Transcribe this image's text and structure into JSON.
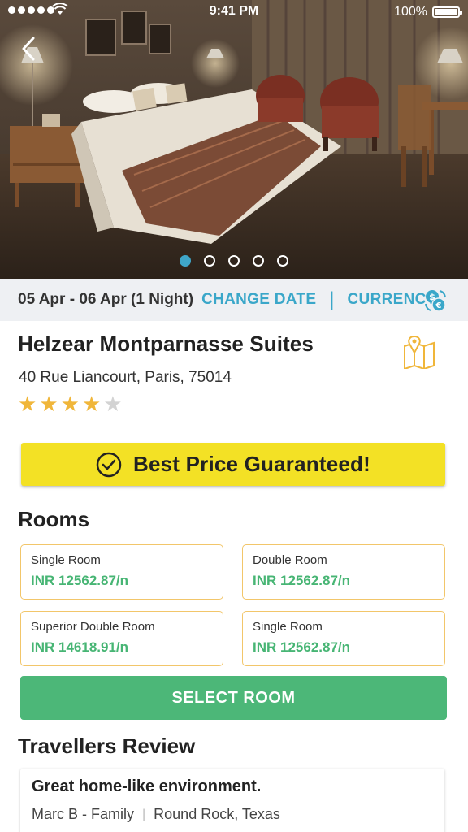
{
  "status_bar": {
    "time": "9:41 PM",
    "battery": "100%"
  },
  "hero": {
    "slides_total": 5,
    "active_slide": 1
  },
  "booking": {
    "dates": "05 Apr - 06 Apr (1 Night)",
    "change_date_label": "CHANGE DATE",
    "currency_label": "CURRENCY"
  },
  "hotel": {
    "name": "Helzear Montparnasse Suites",
    "address": "40 Rue Liancourt, Paris, 75014",
    "rating": 4,
    "rating_max": 5
  },
  "best_price": {
    "label": "Best Price Guaranteed!"
  },
  "rooms": {
    "title": "Rooms",
    "items": [
      {
        "name": "Single Room",
        "price": "INR 12562.87/n"
      },
      {
        "name": "Double Room",
        "price": "INR 12562.87/n"
      },
      {
        "name": "Superior Double Room",
        "price": "INR 14618.91/n"
      },
      {
        "name": "Single Room",
        "price": "INR 12562.87/n"
      }
    ],
    "select_label": "SELECT ROOM"
  },
  "reviews": {
    "title": "Travellers Review",
    "items": [
      {
        "title": "Great home-like environment.",
        "author": "Marc B - Family",
        "location": "Round Rock, Texas"
      }
    ]
  },
  "colors": {
    "accent_blue": "#3aa7c9",
    "price_green": "#47b574",
    "button_green": "#4cb778",
    "banner_yellow": "#f3e125",
    "star_gold": "#f0b63a",
    "card_border": "#f2c66a"
  }
}
